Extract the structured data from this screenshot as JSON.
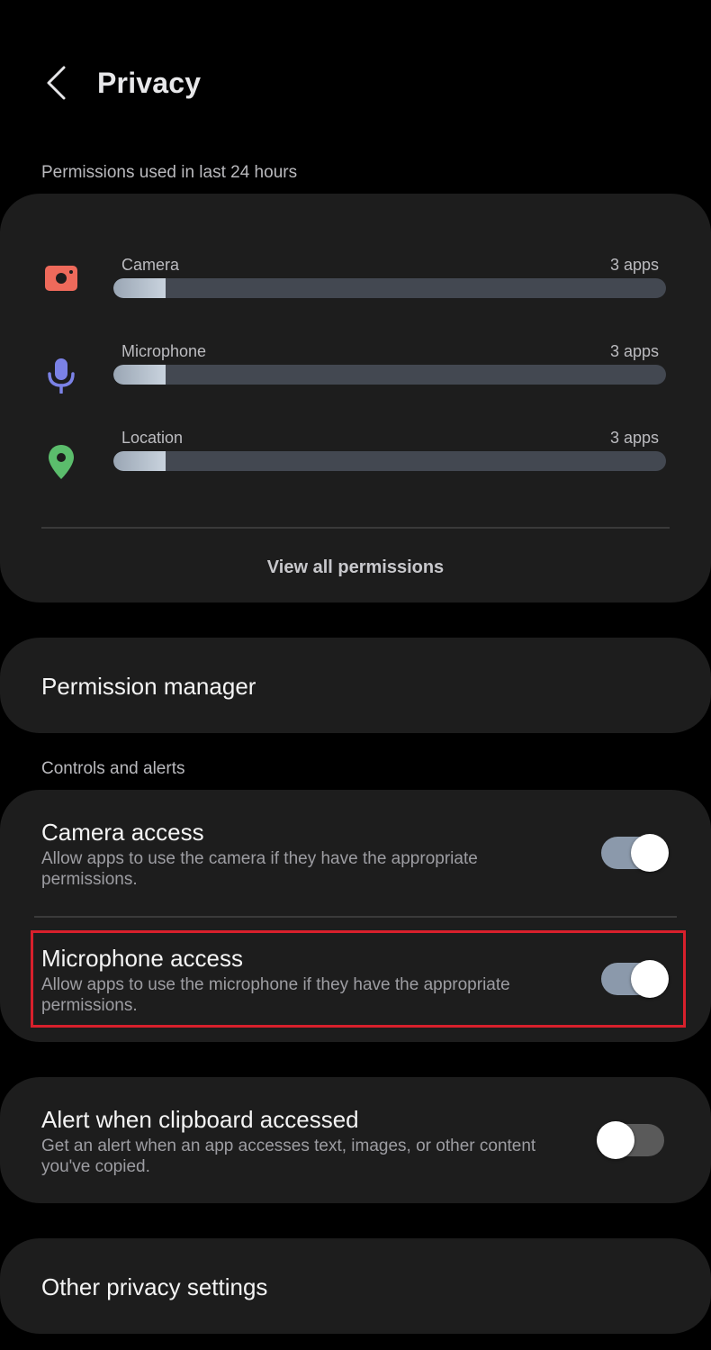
{
  "header": {
    "title": "Privacy",
    "back_icon": "chevron-left-icon"
  },
  "usage": {
    "section_label": "Permissions used in last 24 hours",
    "items": [
      {
        "label": "Camera",
        "count": "3 apps",
        "fill_fraction": 0.095,
        "icon": "camera-icon",
        "color": "#ee6a5b"
      },
      {
        "label": "Microphone",
        "count": "3 apps",
        "fill_fraction": 0.095,
        "icon": "microphone-icon",
        "color": "#7b82e6"
      },
      {
        "label": "Location",
        "count": "3 apps",
        "fill_fraction": 0.095,
        "icon": "location-pin-icon",
        "color": "#5bbd6c"
      }
    ],
    "view_all_label": "View all permissions"
  },
  "permission_manager": {
    "label": "Permission manager"
  },
  "controls": {
    "section_label": "Controls and alerts",
    "camera_access": {
      "title": "Camera access",
      "description_line1": "Allow apps to use the camera if they have the appropriate",
      "description_line2": "permissions.",
      "enabled": true
    },
    "microphone_access": {
      "title": "Microphone access",
      "description_line1": "Allow apps to use the microphone if they have the appropriate",
      "description_line2": "permissions.",
      "enabled": true
    }
  },
  "clipboard_alert": {
    "title": "Alert when clipboard accessed",
    "description_line1": "Get an alert when an app accesses text, images, or other content",
    "description_line2": "you've copied.",
    "enabled": false
  },
  "other_privacy": {
    "label": "Other privacy settings"
  },
  "colors": {
    "background": "#000000",
    "card": "#1d1d1d",
    "toggle_on": "#8b99ab",
    "toggle_off": "#5a5a5a",
    "highlight": "#d8202c"
  }
}
